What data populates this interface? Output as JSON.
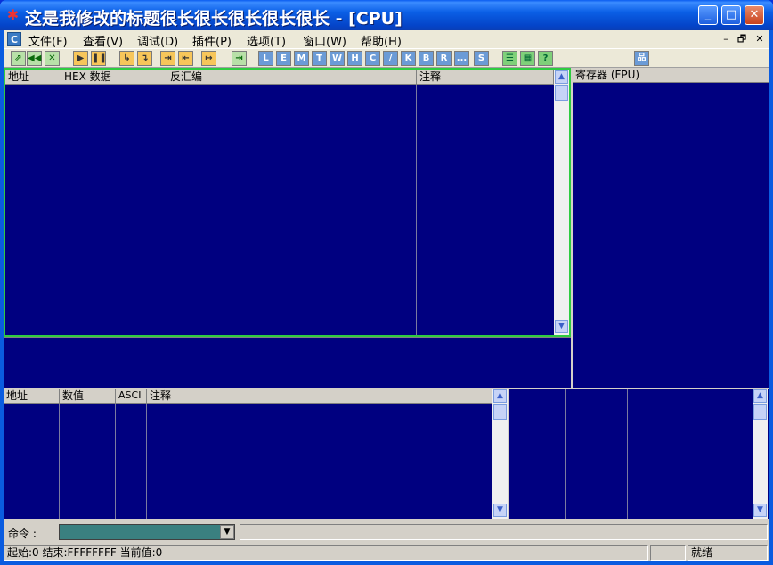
{
  "window": {
    "title": "这是我修改的标题很长很长很长很长很长 - [CPU]"
  },
  "titlebar_buttons": [
    "minimize",
    "maximize",
    "close"
  ],
  "menu": {
    "items": [
      "文件(F)",
      "查看(V)",
      "调试(D)",
      "插件(P)",
      "选项(T)",
      "窗口(W)",
      "帮助(H)"
    ],
    "mdi_controls": [
      "–",
      "🗗",
      "✕"
    ]
  },
  "toolbar": {
    "buttons": [
      {
        "label": "⇗",
        "style": "g"
      },
      {
        "label": "◀◀",
        "style": "g"
      },
      {
        "label": "✕",
        "style": "g"
      },
      {
        "label": "▶",
        "style": "o"
      },
      {
        "label": "❚❚",
        "style": "o"
      },
      {
        "label": "↳",
        "style": "o"
      },
      {
        "label": "↴",
        "style": "o"
      },
      {
        "label": "⇥",
        "style": "o"
      },
      {
        "label": "⇤",
        "style": "o"
      },
      {
        "label": "↦",
        "style": "o"
      },
      {
        "label": "⇥",
        "style": "g"
      },
      {
        "label": "L",
        "style": "b"
      },
      {
        "label": "E",
        "style": "b"
      },
      {
        "label": "M",
        "style": "b"
      },
      {
        "label": "T",
        "style": "b"
      },
      {
        "label": "W",
        "style": "b"
      },
      {
        "label": "H",
        "style": "b"
      },
      {
        "label": "C",
        "style": "b"
      },
      {
        "label": "/",
        "style": "b"
      },
      {
        "label": "K",
        "style": "b"
      },
      {
        "label": "B",
        "style": "b"
      },
      {
        "label": "R",
        "style": "b"
      },
      {
        "label": "...",
        "style": "b"
      },
      {
        "label": "S",
        "style": "b"
      },
      {
        "label": "☰",
        "style": "gr"
      },
      {
        "label": "▦",
        "style": "gr"
      },
      {
        "label": "?",
        "style": "gr"
      },
      {
        "label": "品",
        "style": "b"
      }
    ]
  },
  "disasm": {
    "headers": [
      "地址",
      "HEX 数据",
      "反汇编",
      "注释"
    ]
  },
  "registers": {
    "header": "寄存器 (FPU)"
  },
  "dump": {
    "headers": [
      "地址",
      "数值",
      "ASCI",
      "注释"
    ]
  },
  "command": {
    "label": "命令 :",
    "value": ""
  },
  "status": {
    "range": "起始:0 结束:FFFFFFFF 当前值:0",
    "state": "就绪"
  },
  "colors": {
    "pane_bg": "#000080",
    "active_border": "#2ecc40"
  }
}
